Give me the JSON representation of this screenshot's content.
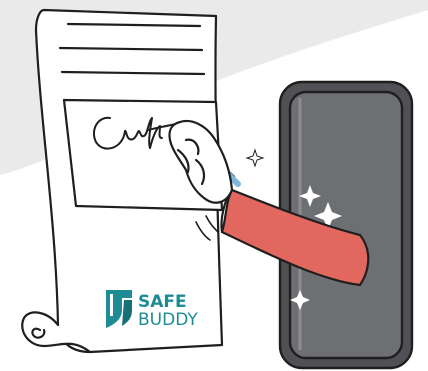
{
  "logo": {
    "line1": "SAFE",
    "line2": "BUDDY"
  },
  "colors": {
    "background": "#ffffff",
    "swoosh": "#eaeaeb",
    "outline": "#1f1f1f",
    "paper": "#ffffff",
    "phone_body": "#505154",
    "phone_screen": "#6d6f73",
    "sleeve": "#e2675f",
    "skin": "#ffffff",
    "pen": "#5a6a8a",
    "pen_tip": "#7fb7d9",
    "brand_teal": "#1d8c95",
    "brand_teal_dark": "#176f77"
  },
  "icons": {
    "document": "contract-document-icon",
    "phone": "smartphone-icon",
    "hand": "writing-hand-icon",
    "pen": "pen-icon",
    "logo_mark": "shield-logo-icon",
    "sparkles": "sparkle-icon"
  }
}
